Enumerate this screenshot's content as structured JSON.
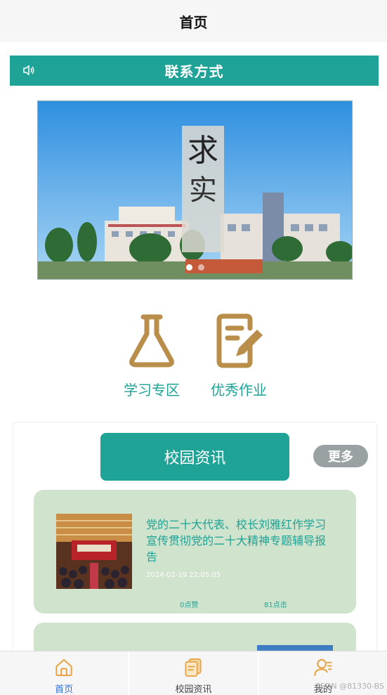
{
  "header": {
    "title": "首页"
  },
  "notice": {
    "text": "联系方式",
    "icon": "speaker-icon"
  },
  "banner": {
    "alt": "campus photo with calligraphy",
    "slides": 2,
    "active_slide": 1
  },
  "quick_links": [
    {
      "label": "学习专区",
      "icon": "flask-icon"
    },
    {
      "label": "优秀作业",
      "icon": "edit-document-icon"
    }
  ],
  "news": {
    "title": "校园资讯",
    "more_label": "更多",
    "items": [
      {
        "title": "党的二十大代表、校长刘雅红作学习宣传贯彻党的二十大精神专题辅导报告",
        "time": "2024-02-19 22:05:05",
        "likes": "0点赞",
        "clicks": "81点击"
      }
    ]
  },
  "tabbar": {
    "items": [
      {
        "label": "首页",
        "icon": "home-icon",
        "active": true
      },
      {
        "label": "校园资讯",
        "icon": "news-icon",
        "active": false
      },
      {
        "label": "我的",
        "icon": "user-icon",
        "active": false
      }
    ]
  },
  "watermark": "CSDN @81330-BS",
  "colors": {
    "accent": "#1fa397",
    "icon_gold": "#b98d4a",
    "card_bg": "#cfe3cd",
    "tab_active": "#2b6fd6"
  }
}
